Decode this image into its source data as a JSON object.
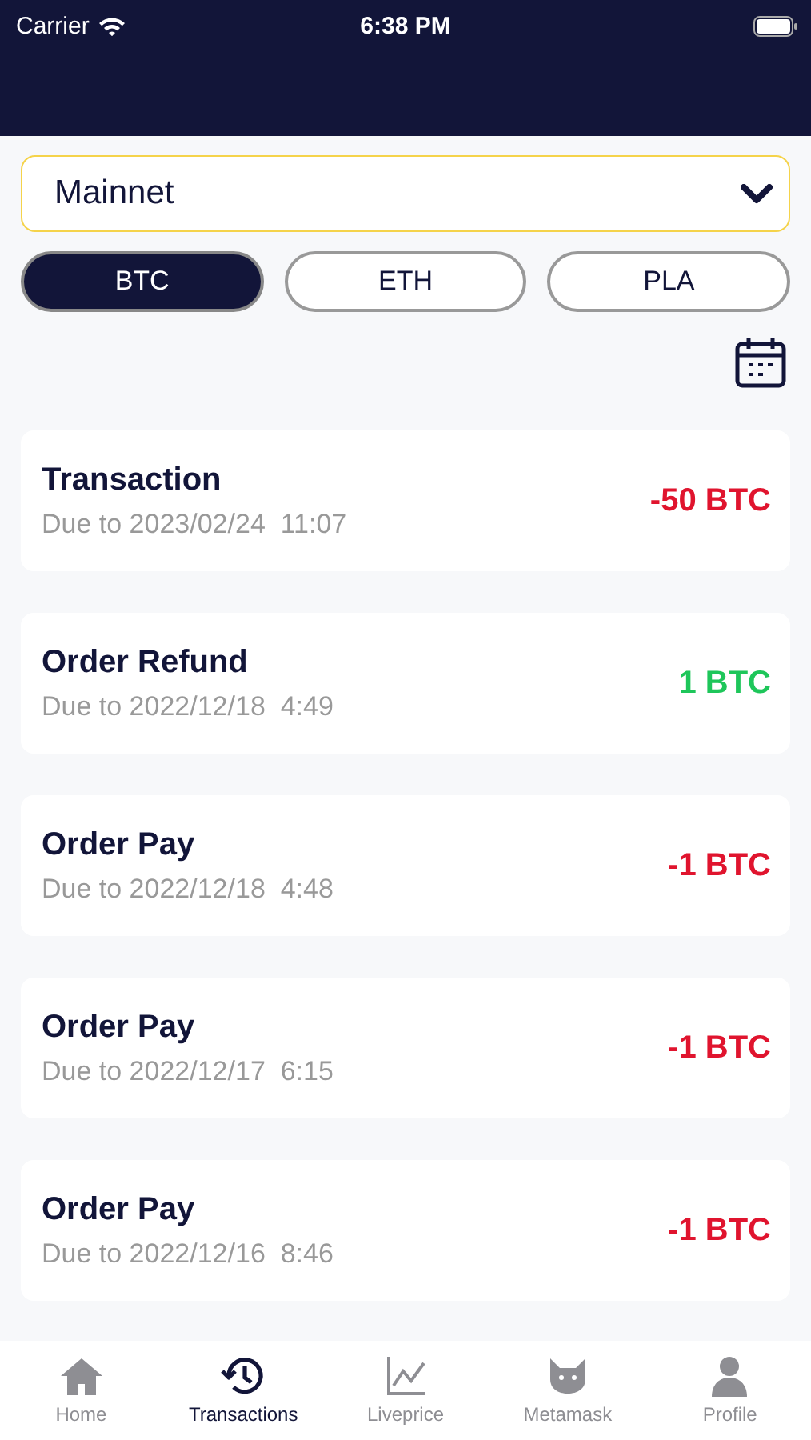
{
  "status_bar": {
    "carrier": "Carrier",
    "time": "6:38 PM"
  },
  "network": {
    "value": "Mainnet"
  },
  "tabs": [
    {
      "label": "BTC",
      "selected": true
    },
    {
      "label": "ETH",
      "selected": false
    },
    {
      "label": "PLA",
      "selected": false
    }
  ],
  "transactions": [
    {
      "title": "Transaction",
      "date": "Due to 2023/02/24  11:07",
      "amount": "-50 BTC",
      "kind": "debit"
    },
    {
      "title": "Order Refund",
      "date": "Due to 2022/12/18  4:49",
      "amount": "1 BTC",
      "kind": "credit"
    },
    {
      "title": "Order Pay",
      "date": "Due to 2022/12/18  4:48",
      "amount": "-1 BTC",
      "kind": "debit"
    },
    {
      "title": "Order Pay",
      "date": "Due to 2022/12/17  6:15",
      "amount": "-1 BTC",
      "kind": "debit"
    },
    {
      "title": "Order Pay",
      "date": "Due to 2022/12/16  8:46",
      "amount": "-1 BTC",
      "kind": "debit"
    }
  ],
  "nav": [
    {
      "label": "Home",
      "selected": false
    },
    {
      "label": "Transactions",
      "selected": true
    },
    {
      "label": "Liveprice",
      "selected": false
    },
    {
      "label": "Metamask",
      "selected": false
    },
    {
      "label": "Profile",
      "selected": false
    }
  ]
}
